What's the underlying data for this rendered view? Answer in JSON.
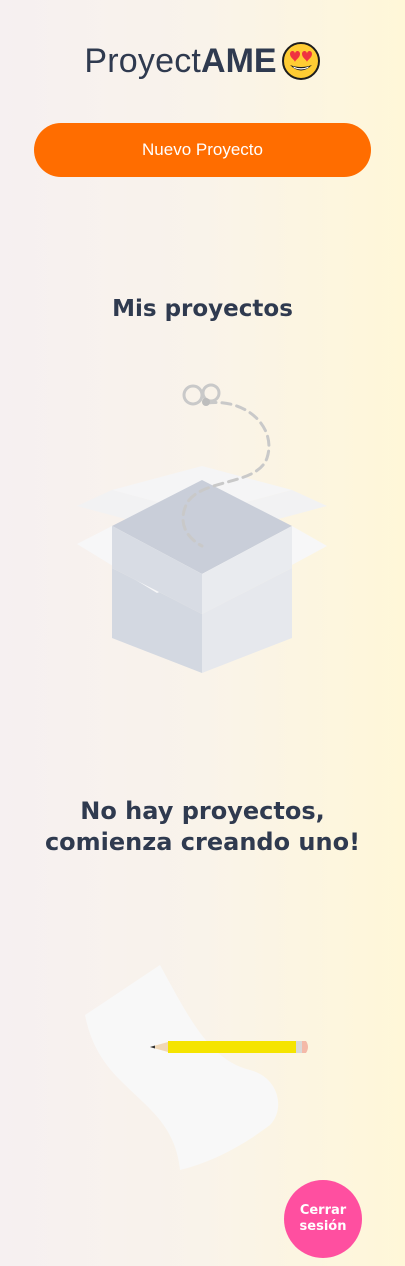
{
  "app": {
    "title_light": "Proyect",
    "title_bold": "AME",
    "logo_icon": "heart-eyes-emoji-icon"
  },
  "actions": {
    "new_project_label": "Nuevo Proyecto",
    "logout_label": "Cerrar sesión"
  },
  "projects": {
    "heading": "Mis proyectos",
    "empty_message": "No hay proyectos, comienza creando uno!",
    "items": []
  },
  "illustrations": {
    "empty_box": "empty-box-icon",
    "paper_pencil": "paper-pencil-icon"
  },
  "colors": {
    "brand_orange": "#ff6d00",
    "logout_pink": "#ff4fa0",
    "text_dark": "#2f3a4f"
  }
}
